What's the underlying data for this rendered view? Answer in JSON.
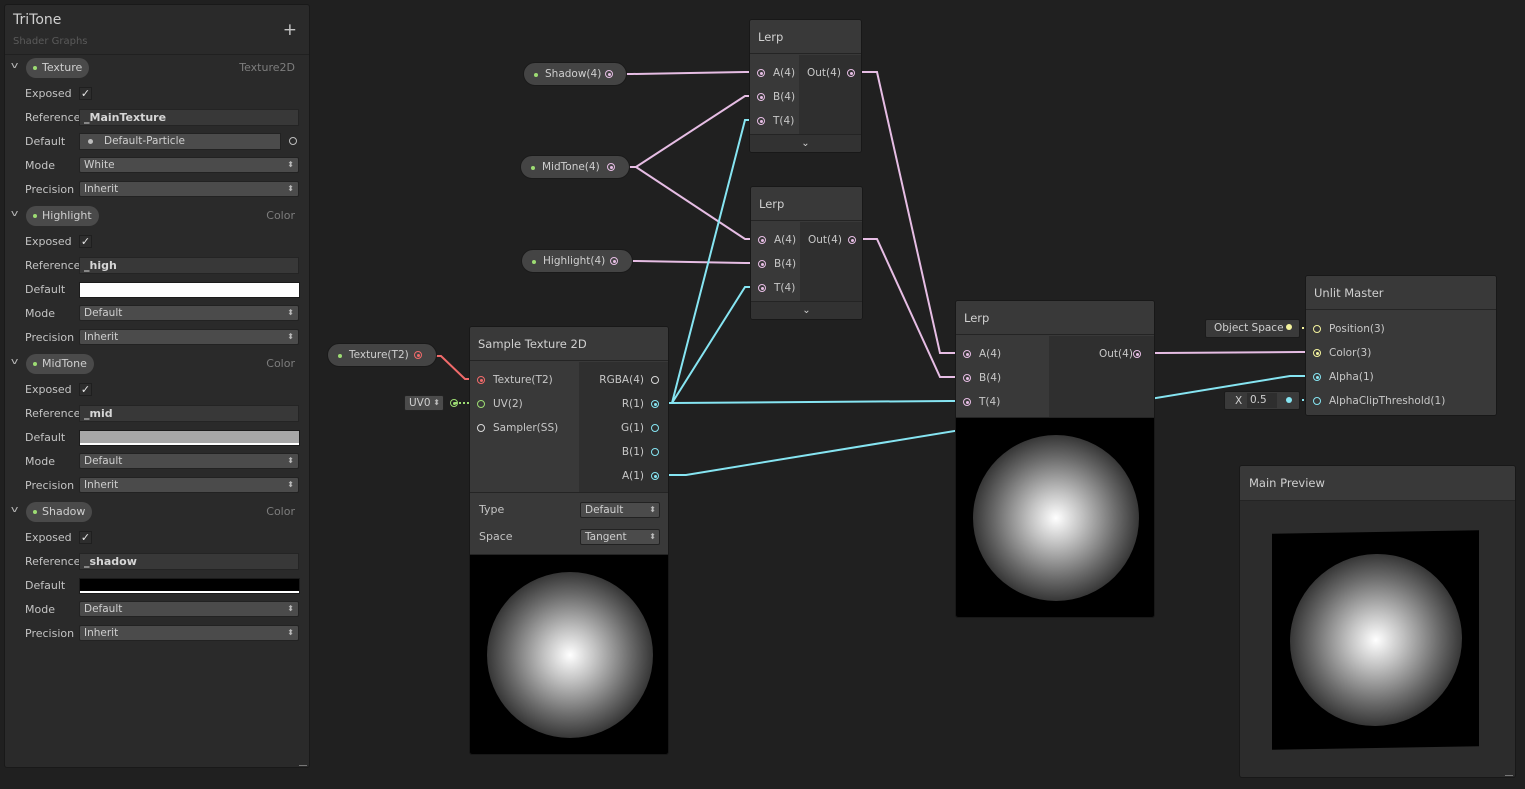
{
  "blackboard": {
    "title": "TriTone",
    "subtitle": "Shader Graphs",
    "add_label": "+",
    "labels": {
      "exposed": "Exposed",
      "reference": "Reference",
      "default": "Default",
      "mode": "Mode",
      "precision": "Precision"
    },
    "properties": [
      {
        "name": "Texture",
        "type": "Texture2D",
        "exposed": true,
        "reference": "_MainTexture",
        "default": "Default-Particle",
        "mode": "White",
        "precision": "Inherit"
      },
      {
        "name": "Highlight",
        "type": "Color",
        "exposed": true,
        "reference": "_high",
        "default_color": "#ffffff",
        "mode": "Default",
        "precision": "Inherit"
      },
      {
        "name": "MidTone",
        "type": "Color",
        "exposed": true,
        "reference": "_mid",
        "default_color": "#a7a7a7",
        "mode": "Default",
        "precision": "Inherit"
      },
      {
        "name": "Shadow",
        "type": "Color",
        "exposed": true,
        "reference": "_shadow",
        "default_color": "#000000",
        "mode": "Default",
        "precision": "Inherit"
      }
    ]
  },
  "canvas_properties": {
    "shadow": "Shadow(4)",
    "midtone": "MidTone(4)",
    "highlight": "Highlight(4)",
    "texture": "Texture(T2)"
  },
  "lerp_nodes": [
    {
      "title": "Lerp",
      "a": "A(4)",
      "b": "B(4)",
      "t": "T(4)",
      "out": "Out(4)"
    },
    {
      "title": "Lerp",
      "a": "A(4)",
      "b": "B(4)",
      "t": "T(4)",
      "out": "Out(4)"
    },
    {
      "title": "Lerp",
      "a": "A(4)",
      "b": "B(4)",
      "t": "T(4)",
      "out": "Out(4)"
    }
  ],
  "collapse_icon": "chevron-down",
  "sample_texture": {
    "title": "Sample Texture 2D",
    "inputs": [
      "Texture(T2)",
      "UV(2)",
      "Sampler(SS)"
    ],
    "outputs": [
      "RGBA(4)",
      "R(1)",
      "G(1)",
      "B(1)",
      "A(1)"
    ],
    "type_label": "Type",
    "type_value": "Default",
    "space_label": "Space",
    "space_value": "Tangent",
    "uv_slot": "UV0"
  },
  "unlit_master": {
    "title": "Unlit Master",
    "inputs": [
      "Position(3)",
      "Color(3)",
      "Alpha(1)",
      "AlphaClipThreshold(1)"
    ],
    "position_slot": "Object Space",
    "alpha_clip_label": "X",
    "alpha_clip_value": "0.5"
  },
  "main_preview": {
    "title": "Main Preview"
  },
  "colors": {
    "background": "#202020",
    "vector4_wire": "#e6bde4",
    "float_wire": "#86e5f2",
    "texture_port": "#f06a6a",
    "property_dot": "#9ddc73",
    "vector3_port": "#f4f39d"
  }
}
